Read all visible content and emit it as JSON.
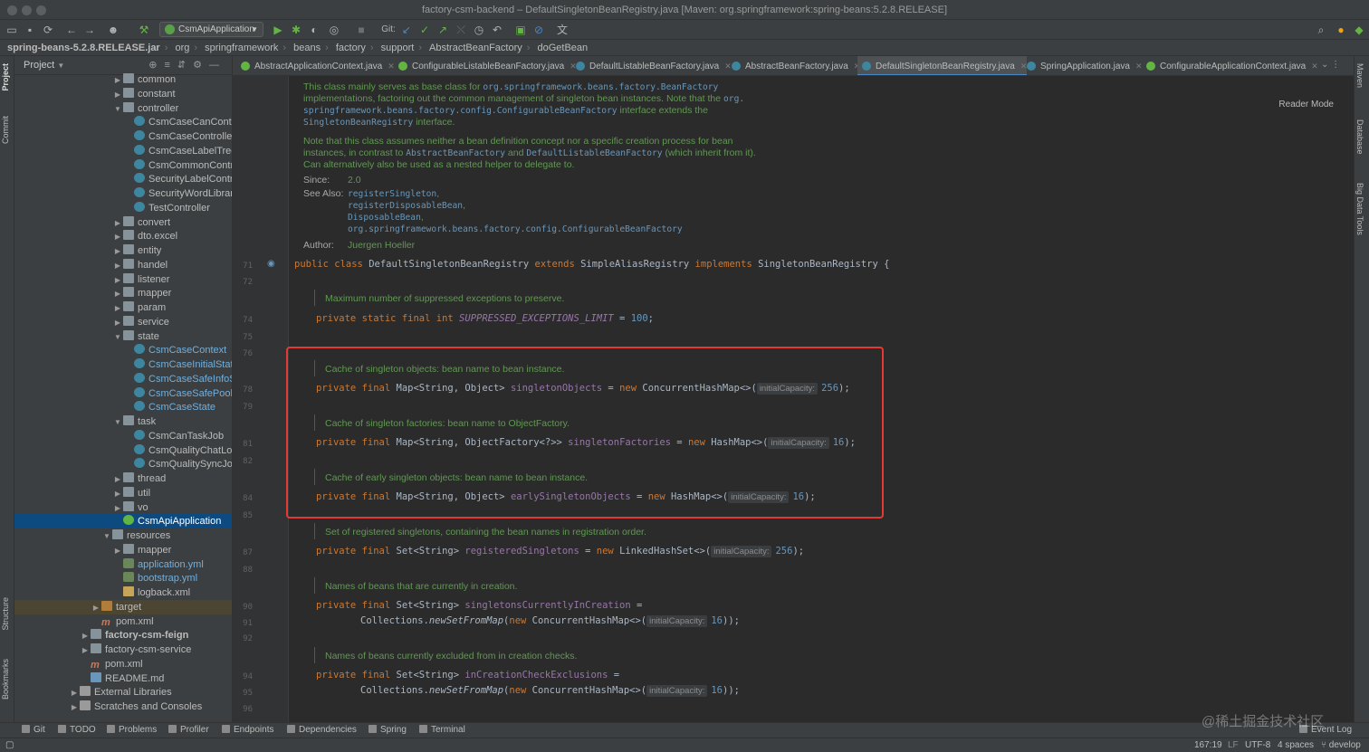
{
  "window": {
    "title": "factory-csm-backend – DefaultSingletonBeanRegistry.java [Maven: org.springframework:spring-beans:5.2.8.RELEASE]"
  },
  "toolbar": {
    "run_config": "CsmApiApplication",
    "git_label": "Git:"
  },
  "breadcrumbs": [
    "spring-beans-5.2.8.RELEASE.jar",
    "org",
    "springframework",
    "beans",
    "factory",
    "support",
    "AbstractBeanFactory",
    "doGetBean"
  ],
  "left_strip": {
    "project": "Project",
    "commit": "Commit",
    "structure": "Structure",
    "bookmarks": "Bookmarks"
  },
  "project_panel": {
    "title": "Project",
    "tree": [
      {
        "label": "common",
        "type": "folder",
        "level": 2,
        "chev": "closed"
      },
      {
        "label": "constant",
        "type": "folder",
        "level": 2,
        "chev": "closed"
      },
      {
        "label": "controller",
        "type": "folder",
        "level": 2,
        "chev": "open"
      },
      {
        "label": "CsmCaseCanControlle",
        "type": "cls",
        "level": 3
      },
      {
        "label": "CsmCaseController",
        "type": "cls",
        "level": 3
      },
      {
        "label": "CsmCaseLabelTreeCo",
        "type": "cls",
        "level": 3
      },
      {
        "label": "CsmCommonControlle",
        "type": "cls",
        "level": 3
      },
      {
        "label": "SecurityLabelControlle",
        "type": "cls",
        "level": 3
      },
      {
        "label": "SecurityWordLibraryC",
        "type": "cls",
        "level": 3
      },
      {
        "label": "TestController",
        "type": "cls",
        "level": 3
      },
      {
        "label": "convert",
        "type": "folder",
        "level": 2,
        "chev": "closed"
      },
      {
        "label": "dto.excel",
        "type": "folder",
        "level": 2,
        "chev": "closed"
      },
      {
        "label": "entity",
        "type": "folder",
        "level": 2,
        "chev": "closed"
      },
      {
        "label": "handel",
        "type": "folder",
        "level": 2,
        "chev": "closed"
      },
      {
        "label": "listener",
        "type": "folder",
        "level": 2,
        "chev": "closed"
      },
      {
        "label": "mapper",
        "type": "folder",
        "level": 2,
        "chev": "closed"
      },
      {
        "label": "param",
        "type": "folder",
        "level": 2,
        "chev": "closed"
      },
      {
        "label": "service",
        "type": "folder",
        "level": 2,
        "chev": "closed"
      },
      {
        "label": "state",
        "type": "folder",
        "level": 2,
        "chev": "open"
      },
      {
        "label": "CsmCaseContext",
        "type": "cls",
        "level": 3,
        "blue": true
      },
      {
        "label": "CsmCaseInitialState",
        "type": "cls",
        "level": 3,
        "blue": true
      },
      {
        "label": "CsmCaseSafeInfoState",
        "type": "cls",
        "level": 3,
        "blue": true
      },
      {
        "label": "CsmCaseSafePoolStat",
        "type": "cls",
        "level": 3,
        "blue": true
      },
      {
        "label": "CsmCaseState",
        "type": "cls",
        "level": 3,
        "blue": true
      },
      {
        "label": "task",
        "type": "folder",
        "level": 2,
        "chev": "open"
      },
      {
        "label": "CsmCanTaskJob",
        "type": "cls",
        "level": 3
      },
      {
        "label": "CsmQualityChatLogJo",
        "type": "cls",
        "level": 3
      },
      {
        "label": "CsmQualitySyncJob",
        "type": "cls",
        "level": 3
      },
      {
        "label": "thread",
        "type": "folder",
        "level": 2,
        "chev": "closed"
      },
      {
        "label": "util",
        "type": "folder",
        "level": 2,
        "chev": "closed"
      },
      {
        "label": "vo",
        "type": "folder",
        "level": 2,
        "chev": "closed"
      },
      {
        "label": "CsmApiApplication",
        "type": "cls-g",
        "level": 2,
        "selected": true
      },
      {
        "label": "resources",
        "type": "folder",
        "level": 1,
        "chev": "open"
      },
      {
        "label": "mapper",
        "type": "folder",
        "level": 2,
        "chev": "closed"
      },
      {
        "label": "application.yml",
        "type": "yml",
        "level": 2,
        "blue": true
      },
      {
        "label": "bootstrap.yml",
        "type": "yml",
        "level": 2,
        "blue": true
      },
      {
        "label": "logback.xml",
        "type": "xml",
        "level": 2
      },
      {
        "label": "target",
        "type": "folder-o",
        "level": 0,
        "chev": "closed",
        "highlight": true
      },
      {
        "label": "pom.xml",
        "type": "maven",
        "level": 0
      },
      {
        "label": "factory-csm-feign",
        "type": "folder",
        "level": -1,
        "chev": "closed",
        "bold": true
      },
      {
        "label": "factory-csm-service",
        "type": "folder",
        "level": -1,
        "chev": "closed"
      },
      {
        "label": "pom.xml",
        "type": "maven",
        "level": -1
      },
      {
        "label": "README.md",
        "type": "md",
        "level": -1
      },
      {
        "label": "External Libraries",
        "type": "lib",
        "level": -2,
        "chev": "closed"
      },
      {
        "label": "Scratches and Consoles",
        "type": "lib",
        "level": -2,
        "chev": "closed"
      }
    ]
  },
  "tabs": [
    {
      "label": "AbstractApplicationContext.java",
      "icon": "i"
    },
    {
      "label": "ConfigurableListableBeanFactory.java",
      "icon": "i"
    },
    {
      "label": "DefaultListableBeanFactory.java",
      "icon": "c"
    },
    {
      "label": "AbstractBeanFactory.java",
      "icon": "c"
    },
    {
      "label": "DefaultSingletonBeanRegistry.java",
      "icon": "c",
      "active": true
    },
    {
      "label": "SpringApplication.java",
      "icon": "c"
    },
    {
      "label": "ConfigurableApplicationContext.java",
      "icon": "i"
    }
  ],
  "editor": {
    "reader_mode": "Reader Mode",
    "javadoc": {
      "p1_l1a": "This class mainly serves as base class for ",
      "p1_l1b": "org.springframework.beans.factory.BeanFactory",
      "p1_l2a": "implementations, factoring out the common management of singleton bean instances. Note that the ",
      "p1_l2b": "org.",
      "p1_l3a": "springframework.beans.factory.config.ConfigurableBeanFactory",
      "p1_l3b": " interface extends the",
      "p1_l4a": "SingletonBeanRegistry",
      "p1_l4b": " interface.",
      "p2_l1": "Note that this class assumes neither a bean definition concept nor a specific creation process for bean",
      "p2_l2a": "instances, in contrast to ",
      "p2_l2b": "AbstractBeanFactory",
      "p2_l2c": " and ",
      "p2_l2d": "DefaultListableBeanFactory",
      "p2_l2e": " (which inherit from it).",
      "p2_l3": "Can alternatively also be used as a nested helper to delegate to.",
      "since_label": "Since:",
      "since_value": "2.0",
      "see_label": "See Also:",
      "see_1": "registerSingleton",
      "see_1s": ",",
      "see_2": "registerDisposableBean",
      "see_2s": ",",
      "see_3": "DisposableBean",
      "see_3s": ",",
      "see_4": "org.springframework.beans.factory.config.ConfigurableBeanFactory",
      "author_label": "Author:",
      "author_value": "Juergen Hoeller"
    },
    "line_numbers": [
      "71",
      "72",
      "74",
      "75",
      "76",
      "78",
      "79",
      "81",
      "82",
      "84",
      "85",
      "87",
      "88",
      "90",
      "91",
      "92",
      "94",
      "95",
      "96"
    ],
    "code": {
      "l71_public": "public ",
      "l71_class": "class ",
      "l71_name": "DefaultSingletonBeanRegistry ",
      "l71_extends": "extends ",
      "l71_super": "SimpleAliasRegistry ",
      "l71_impl": "implements ",
      "l71_iface": "SingletonBeanRegistry {",
      "doc_suppressed": "Maximum number of suppressed exceptions to preserve.",
      "l74_mods": "private static final int ",
      "l74_field": "SUPPRESSED_EXCEPTIONS_LIMIT",
      "l74_eq": " = ",
      "l74_val": "100",
      "l74_end": ";",
      "doc_singletons": "Cache of singleton objects: bean name to bean instance.",
      "l78_mods": "private final ",
      "l78_type": "Map<String, Object> ",
      "l78_field": "singletonObjects",
      "l78_eq": " = ",
      "l78_new": "new ",
      "l78_ctor": "ConcurrentHashMap<>(",
      "l78_hint": "initialCapacity:",
      "l78_val": "256",
      "l78_end": ");",
      "doc_factories": "Cache of singleton factories: bean name to ObjectFactory.",
      "l81_mods": "private final ",
      "l81_type": "Map<String, ObjectFactory<?>> ",
      "l81_field": "singletonFactories",
      "l81_eq": " = ",
      "l81_new": "new ",
      "l81_ctor": "HashMap<>(",
      "l81_hint": "initialCapacity:",
      "l81_val": "16",
      "l81_end": ");",
      "doc_early": "Cache of early singleton objects: bean name to bean instance.",
      "l84_mods": "private final ",
      "l84_type": "Map<String, Object> ",
      "l84_field": "earlySingletonObjects",
      "l84_eq": " = ",
      "l84_new": "new ",
      "l84_ctor": "HashMap<>(",
      "l84_hint": "initialCapacity:",
      "l84_val": "16",
      "l84_end": ");",
      "doc_registered": "Set of registered singletons, containing the bean names in registration order.",
      "l87_mods": "private final ",
      "l87_type": "Set<String> ",
      "l87_field": "registeredSingletons",
      "l87_eq": " = ",
      "l87_new": "new ",
      "l87_ctor": "LinkedHashSet<>(",
      "l87_hint": "initialCapacity:",
      "l87_val": "256",
      "l87_end": ");",
      "doc_creation": "Names of beans that are currently in creation.",
      "l90_mods": "private final ",
      "l90_type": "Set<String> ",
      "l90_field": "singletonsCurrentlyInCreation",
      "l90_eq": " =",
      "l91_pre": "Collections.",
      "l91_m": "newSetFromMap",
      "l91_open": "(",
      "l91_new": "new ",
      "l91_ctor": "ConcurrentHashMap<>(",
      "l91_hint": "initialCapacity:",
      "l91_val": "16",
      "l91_end": "));",
      "doc_excluded": "Names of beans currently excluded from in creation checks.",
      "l94_mods": "private final ",
      "l94_type": "Set<String> ",
      "l94_field": "inCreationCheckExclusions",
      "l94_eq": " =",
      "l95_pre": "Collections.",
      "l95_m": "newSetFromMap",
      "l95_open": "(",
      "l95_new": "new ",
      "l95_ctor": "ConcurrentHashMap<>(",
      "l95_hint": "initialCapacity:",
      "l95_val": "16",
      "l95_end": "));"
    }
  },
  "right_strip": {
    "maven": "Maven",
    "database": "Database",
    "bigdata": "Big Data Tools"
  },
  "bottom_tools": [
    "Git",
    "TODO",
    "Problems",
    "Profiler",
    "Endpoints",
    "Dependencies",
    "Spring",
    "Terminal"
  ],
  "event_log": "Event Log",
  "status": {
    "position": "167:19",
    "line_sep": "LF",
    "encoding": "UTF-8",
    "indent": "4 spaces",
    "branch": "develop"
  },
  "watermark": "@稀土掘金技术社区",
  "colors": {
    "highlight": "#e53935",
    "selection": "#0d4a80",
    "accent": "#4a88c7"
  }
}
